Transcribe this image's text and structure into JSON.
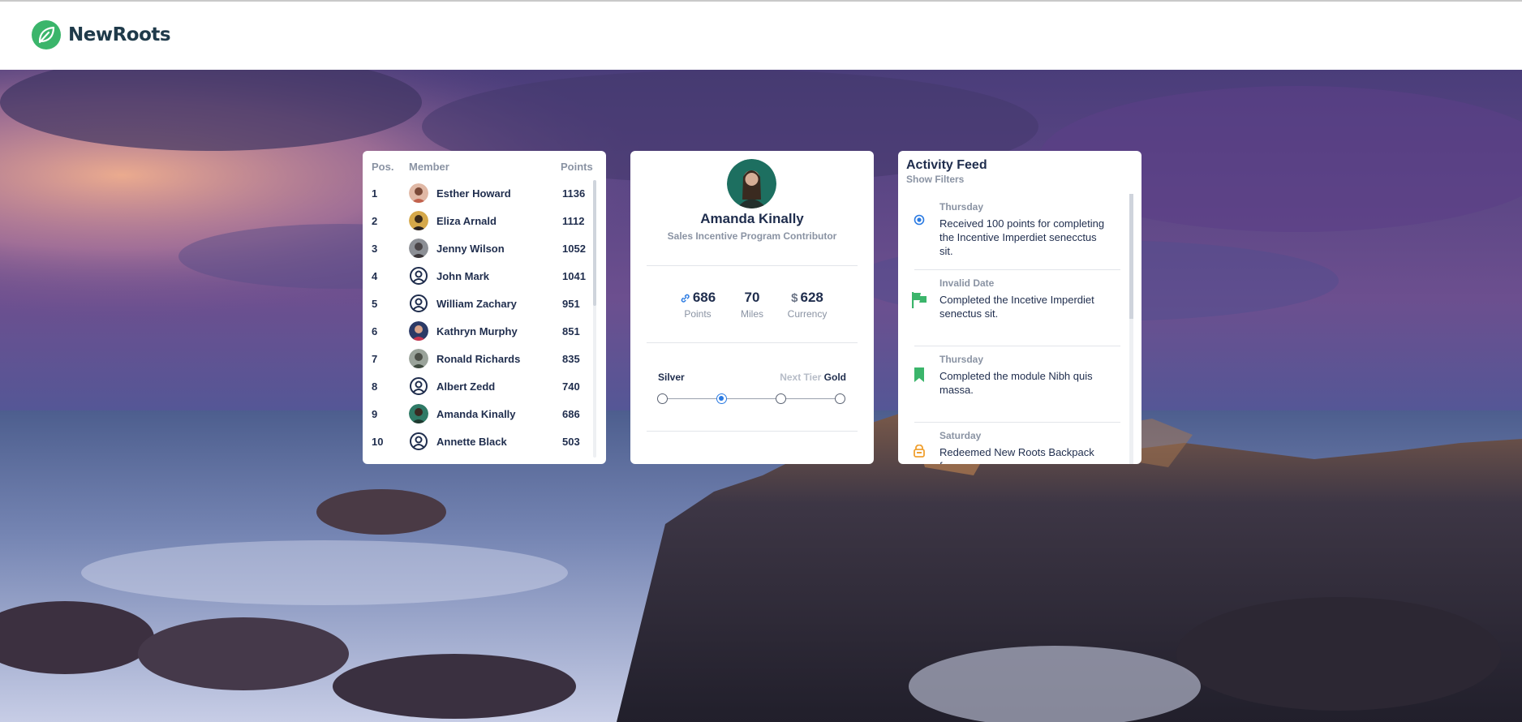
{
  "brand": {
    "name": "NewRoots",
    "icon": "leaf-icon",
    "color": "#3bb56b"
  },
  "leaderboard": {
    "headers": {
      "pos": "Pos.",
      "member": "Member",
      "points": "Points"
    },
    "rows": [
      {
        "pos": "1",
        "name": "Esther Howard",
        "points": "1136",
        "avatar": "photo"
      },
      {
        "pos": "2",
        "name": "Eliza Arnald",
        "points": "1112",
        "avatar": "photo"
      },
      {
        "pos": "3",
        "name": "Jenny Wilson",
        "points": "1052",
        "avatar": "photo"
      },
      {
        "pos": "4",
        "name": "John Mark",
        "points": "1041",
        "avatar": "user-icon"
      },
      {
        "pos": "5",
        "name": "William Zachary",
        "points": "951",
        "avatar": "user-icon"
      },
      {
        "pos": "6",
        "name": "Kathryn Murphy",
        "points": "851",
        "avatar": "photo"
      },
      {
        "pos": "7",
        "name": "Ronald Richards",
        "points": "835",
        "avatar": "photo"
      },
      {
        "pos": "8",
        "name": "Albert Zedd",
        "points": "740",
        "avatar": "user-icon"
      },
      {
        "pos": "9",
        "name": "Amanda Kinally",
        "points": "686",
        "avatar": "photo"
      },
      {
        "pos": "10",
        "name": "Annette Black",
        "points": "503",
        "avatar": "user-icon"
      }
    ]
  },
  "profile": {
    "name": "Amanda Kinally",
    "role": "Sales Incentive Program Contributor",
    "stats": [
      {
        "value": "686",
        "label": "Points",
        "icon": "link-icon"
      },
      {
        "value": "70",
        "label": "Miles",
        "icon": ""
      },
      {
        "value": "628",
        "label": "Currency",
        "icon": "dollar-icon",
        "prefix": "$"
      }
    ],
    "tier": {
      "current": "Silver",
      "next_label": "Next Tier",
      "next": "Gold",
      "steps": 4,
      "active_step": 2
    }
  },
  "activity": {
    "title": "Activity Feed",
    "filter_label": "Show Filters",
    "items": [
      {
        "date": "Thursday",
        "text": "Received 100 points for completing the Incentive Imperdiet senecctus sit.",
        "icon": "target-icon",
        "color": "#2a7ae2"
      },
      {
        "date": "Invalid Date",
        "text": "Completed the Incetive Imperdiet senectus sit.",
        "icon": "flag-icon",
        "color": "#3bb56b"
      },
      {
        "date": "Thursday",
        "text": "Completed the module Nibh quis massa.",
        "icon": "bookmark-icon",
        "color": "#3bb56b"
      },
      {
        "date": "Saturday",
        "text": "Redeemed New Roots Backpack for",
        "icon": "bag-icon",
        "color": "#f0a030"
      }
    ]
  }
}
